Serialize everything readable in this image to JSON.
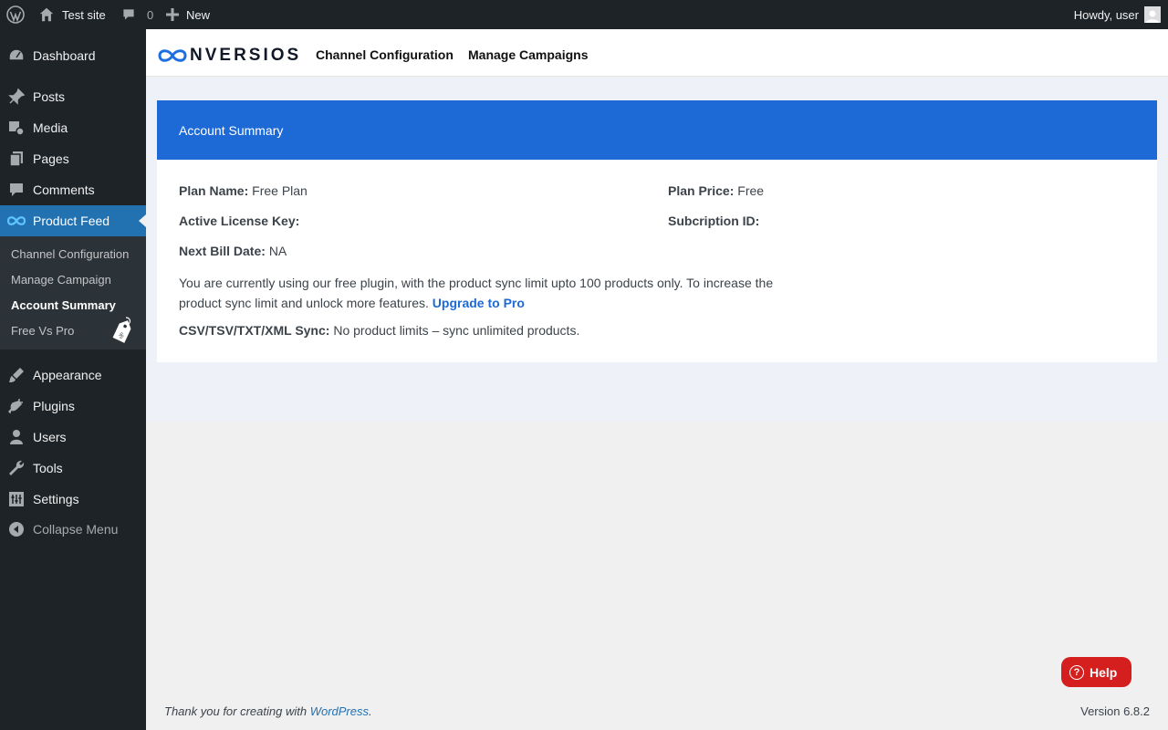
{
  "adminbar": {
    "site_name": "Test site",
    "comments_count": "0",
    "new_label": "New",
    "greeting": "Howdy, user"
  },
  "sidebar": {
    "items": [
      {
        "label": "Dashboard",
        "icon": "dashboard-icon"
      },
      {
        "label": "Posts",
        "icon": "pin-icon"
      },
      {
        "label": "Media",
        "icon": "media-icon"
      },
      {
        "label": "Pages",
        "icon": "pages-icon"
      },
      {
        "label": "Comments",
        "icon": "comment-icon"
      },
      {
        "label": "Product Feed",
        "icon": "conversios-icon"
      },
      {
        "label": "Appearance",
        "icon": "brush-icon"
      },
      {
        "label": "Plugins",
        "icon": "plugin-icon"
      },
      {
        "label": "Users",
        "icon": "user-icon"
      },
      {
        "label": "Tools",
        "icon": "wrench-icon"
      },
      {
        "label": "Settings",
        "icon": "settings-icon"
      }
    ],
    "submenu": [
      {
        "label": "Channel Configuration"
      },
      {
        "label": "Manage Campaign"
      },
      {
        "label": "Account Summary"
      },
      {
        "label": "Free Vs Pro"
      }
    ],
    "collapse_label": "Collapse Menu"
  },
  "header": {
    "logo_text": "NVERSIOS",
    "links": [
      "Channel Configuration",
      "Manage Campaigns"
    ]
  },
  "card": {
    "title": "Account Summary",
    "plan_name_label": "Plan Name:",
    "plan_name_value": "Free Plan",
    "plan_price_label": "Plan Price:",
    "plan_price_value": "Free",
    "license_label": "Active License Key:",
    "subscription_label": "Subcription ID:",
    "next_bill_label": "Next Bill Date:",
    "next_bill_value": "NA",
    "paragraph": "You are currently using our free plugin, with the product sync limit upto 100 products only. To increase the product sync limit and unlock more features.",
    "upgrade_link": "Upgrade to Pro",
    "sync_label": "CSV/TSV/TXT/XML Sync:",
    "sync_value": "No product limits – sync unlimited products."
  },
  "footer": {
    "thanks_prefix": "Thank you for creating with ",
    "wordpress_link": "WordPress",
    "thanks_suffix": ".",
    "version": "Version 6.8.2"
  },
  "help_label": "Help",
  "colors": {
    "accent": "#2271b1",
    "card_header": "#1d6ad6",
    "help": "#d51f1f"
  }
}
